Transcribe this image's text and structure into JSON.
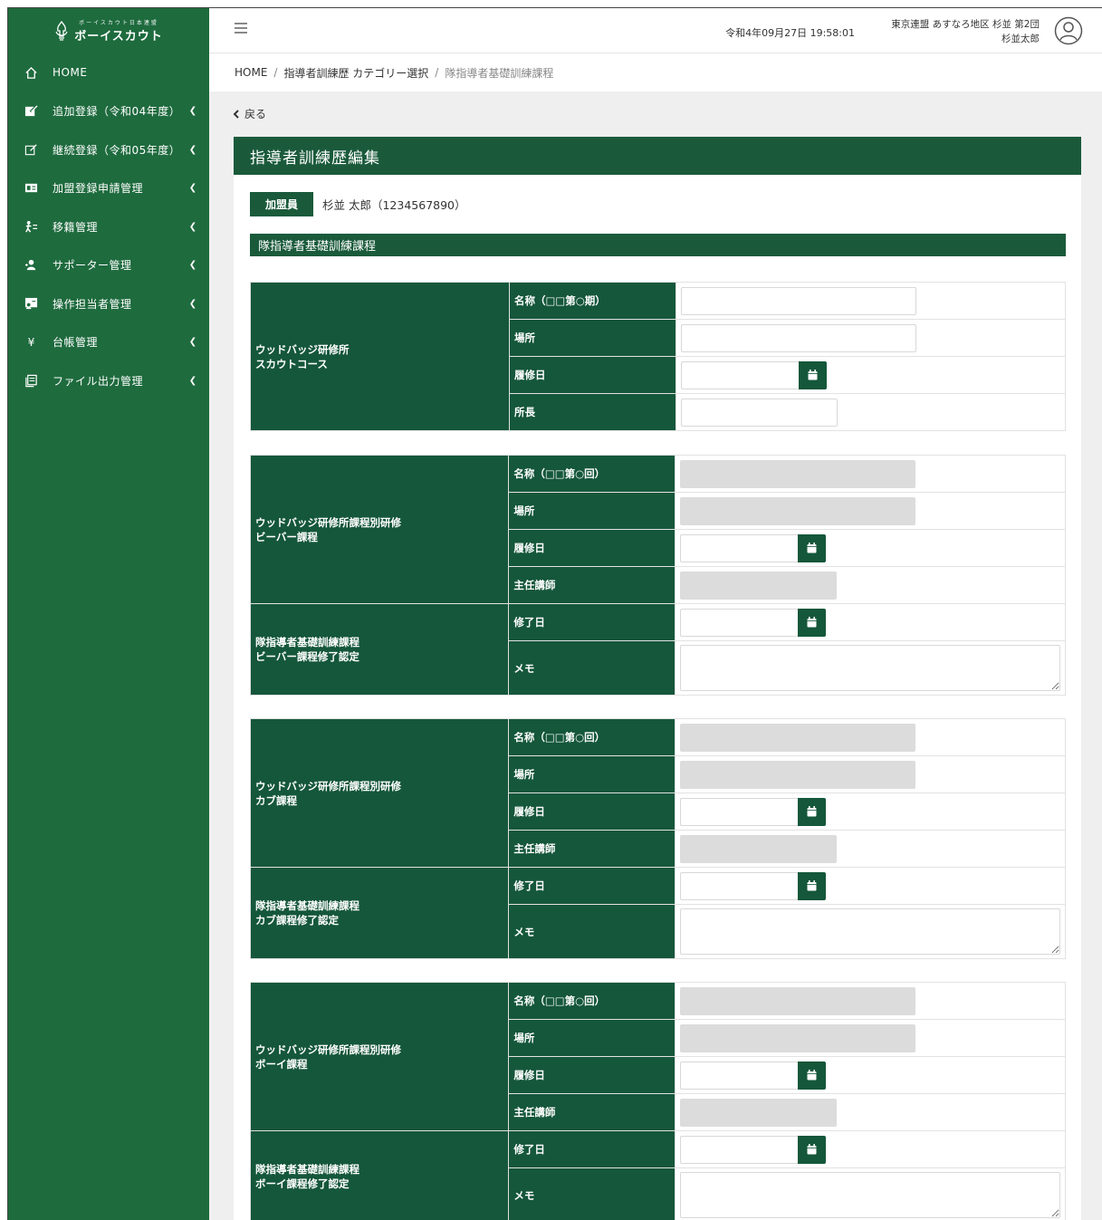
{
  "logo": {
    "sub": "ボーイスカウト日本連盟",
    "title": "ボーイスカウト"
  },
  "sidebar": {
    "items": [
      {
        "label": "HOME",
        "icon": "home-icon",
        "chevron": false
      },
      {
        "label": "追加登録（令和04年度）",
        "icon": "edit-filled-icon",
        "chevron": true
      },
      {
        "label": "継続登録（令和05年度）",
        "icon": "edit-outline-icon",
        "chevron": true
      },
      {
        "label": "加盟登録申請管理",
        "icon": "id-card-icon",
        "chevron": true
      },
      {
        "label": "移籍管理",
        "icon": "transfer-icon",
        "chevron": true
      },
      {
        "label": "サポーター管理",
        "icon": "user-plus-icon",
        "chevron": true
      },
      {
        "label": "操作担当者管理",
        "icon": "user-board-icon",
        "chevron": true
      },
      {
        "label": "台帳管理",
        "icon": "yen-icon",
        "chevron": true
      },
      {
        "label": "ファイル出力管理",
        "icon": "file-copy-icon",
        "chevron": true
      }
    ]
  },
  "header": {
    "datetime": "令和4年09月27日 19:58:01",
    "user_org": "東京連盟 あすなろ地区 杉並 第2団",
    "user_name": "杉並太郎"
  },
  "breadcrumb": {
    "home": "HOME",
    "category": "指導者訓練歴 カテゴリー選択",
    "current": "隊指導者基礎訓練課程"
  },
  "back": {
    "label": "戻る"
  },
  "panel": {
    "title": "指導者訓練歴編集",
    "member_badge": "加盟員",
    "member_name": "杉並 太郎（1234567890）",
    "section_title": "隊指導者基礎訓練課程"
  },
  "tables": [
    {
      "groups": [
        {
          "title": "ウッドバッジ研修所\nスカウトコース",
          "rows": [
            {
              "label": "名称（□□第○期）",
              "type": "text",
              "value": ""
            },
            {
              "label": "場所",
              "type": "text",
              "value": ""
            },
            {
              "label": "履修日",
              "type": "date",
              "value": ""
            },
            {
              "label": "所長",
              "type": "short",
              "value": ""
            }
          ]
        }
      ]
    },
    {
      "groups": [
        {
          "title": "ウッドバッジ研修所課程別研修\nビーバー課程",
          "rows": [
            {
              "label": "名称（□□第○回）",
              "type": "ro",
              "value": ""
            },
            {
              "label": "場所",
              "type": "ro",
              "value": ""
            },
            {
              "label": "履修日",
              "type": "date",
              "value": ""
            },
            {
              "label": "主任講師",
              "type": "ro-short",
              "value": ""
            }
          ]
        },
        {
          "title": "隊指導者基礎訓練課程\nビーバー課程修了認定",
          "rows": [
            {
              "label": "修了日",
              "type": "date",
              "value": ""
            },
            {
              "label": "メモ",
              "type": "memo",
              "value": ""
            }
          ]
        }
      ]
    },
    {
      "groups": [
        {
          "title": "ウッドバッジ研修所課程別研修\nカブ課程",
          "rows": [
            {
              "label": "名称（□□第○回）",
              "type": "ro",
              "value": ""
            },
            {
              "label": "場所",
              "type": "ro",
              "value": ""
            },
            {
              "label": "履修日",
              "type": "date",
              "value": ""
            },
            {
              "label": "主任講師",
              "type": "ro-short",
              "value": ""
            }
          ]
        },
        {
          "title": "隊指導者基礎訓練課程\nカブ課程修了認定",
          "rows": [
            {
              "label": "修了日",
              "type": "date",
              "value": ""
            },
            {
              "label": "メモ",
              "type": "memo",
              "value": ""
            }
          ]
        }
      ]
    },
    {
      "groups": [
        {
          "title": "ウッドバッジ研修所課程別研修\nボーイ課程",
          "rows": [
            {
              "label": "名称（□□第○回）",
              "type": "ro",
              "value": ""
            },
            {
              "label": "場所",
              "type": "ro",
              "value": ""
            },
            {
              "label": "履修日",
              "type": "date",
              "value": ""
            },
            {
              "label": "主任講師",
              "type": "ro-short",
              "value": ""
            }
          ]
        },
        {
          "title": "隊指導者基礎訓練課程\nボーイ課程修了認定",
          "rows": [
            {
              "label": "修了日",
              "type": "date",
              "value": ""
            },
            {
              "label": "メモ",
              "type": "memo",
              "value": ""
            }
          ]
        }
      ]
    }
  ],
  "colors": {
    "sidebar": "#1e6b3e",
    "header_green": "#1a5a3b",
    "cell_green": "#15573b",
    "readonly_gray": "#dcdcdc"
  }
}
